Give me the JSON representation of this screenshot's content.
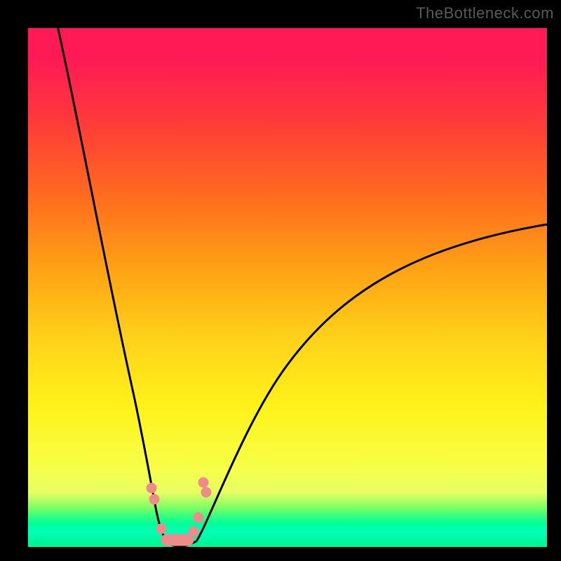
{
  "watermark": "TheBottleneck.com",
  "colors": {
    "background": "#000000",
    "gradient_top": "#ff1a55",
    "gradient_bottom": "#00f590",
    "curve": "#000000",
    "markers": "#ef8b8b"
  },
  "chart_data": {
    "type": "line",
    "title": "",
    "xlabel": "",
    "ylabel": "",
    "x": [
      0,
      0.05,
      0.1,
      0.15,
      0.2,
      0.225,
      0.25,
      0.275,
      0.3,
      0.33,
      0.4,
      0.5,
      0.6,
      0.7,
      0.8,
      0.9,
      1.0
    ],
    "values": [
      1.05,
      0.92,
      0.76,
      0.56,
      0.28,
      0.14,
      0.04,
      0.0,
      0.0,
      0.04,
      0.2,
      0.34,
      0.44,
      0.51,
      0.56,
      0.595,
      0.62
    ],
    "ylim": [
      0,
      1.05
    ],
    "xlim": [
      0,
      1
    ],
    "annotations": {
      "marker_cluster_x_range": [
        0.225,
        0.33
      ],
      "marker_cluster_y_range": [
        0.0,
        0.14
      ]
    }
  }
}
